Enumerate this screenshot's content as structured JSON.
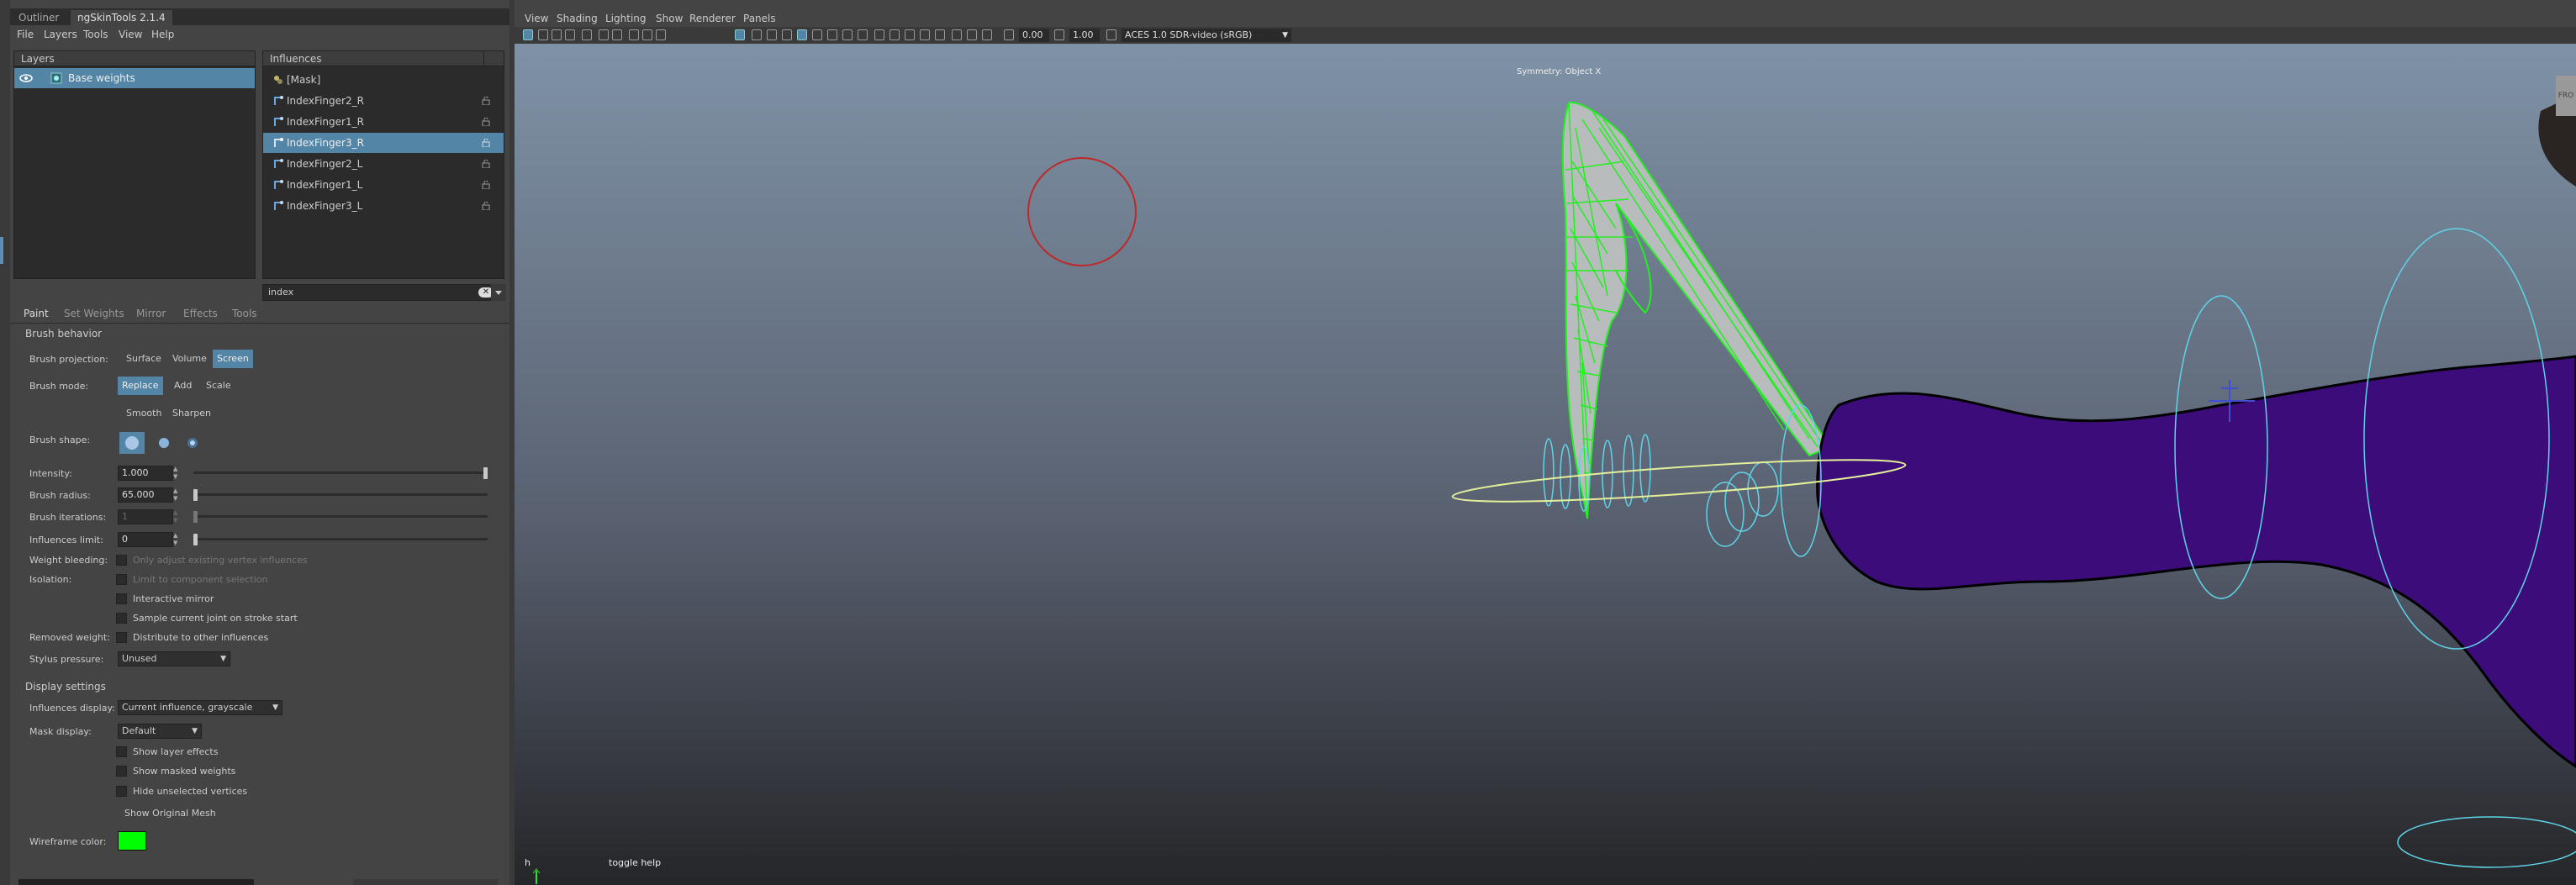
{
  "panel_tabs": [
    "Outliner",
    "ngSkinTools 2.1.4"
  ],
  "menu": [
    "File",
    "Layers",
    "Tools",
    "View",
    "Help"
  ],
  "layers": {
    "header": "Layers",
    "items": [
      {
        "name": "Base weights"
      }
    ]
  },
  "influences": {
    "header": "Influences",
    "items": [
      {
        "name": "[Mask]"
      },
      {
        "name": "IndexFinger2_R"
      },
      {
        "name": "IndexFinger1_R"
      },
      {
        "name": "IndexFinger3_R"
      },
      {
        "name": "IndexFinger2_L"
      },
      {
        "name": "IndexFinger1_L"
      },
      {
        "name": "IndexFinger3_L"
      }
    ],
    "selected": "IndexFinger3_R",
    "search": "index"
  },
  "settings_tabs": [
    "Paint",
    "Set Weights",
    "Mirror",
    "Effects",
    "Tools"
  ],
  "brush": {
    "section": "Brush behavior",
    "projection_label": "Brush projection:",
    "projection_options": [
      "Surface",
      "Volume",
      "Screen"
    ],
    "projection_selected": "Screen",
    "mode_label": "Brush mode:",
    "mode_options": [
      "Replace",
      "Add",
      "Scale"
    ],
    "mode_selected": "Replace",
    "mode_options_2": [
      "Smooth",
      "Sharpen"
    ],
    "shape_label": "Brush shape:",
    "intensity_label": "Intensity:",
    "intensity": "1.000",
    "intensity_level": 1.0,
    "radius_label": "Brush radius:",
    "radius": "65.000",
    "radius_level": 0.0,
    "iterations_label": "Brush iterations:",
    "iterations": "1",
    "iterations_level": 0.0,
    "inf_limit_label": "Influences limit:",
    "inf_limit": "0",
    "inf_limit_level": 0.0,
    "bleed_label": "Weight bleeding:",
    "bleed_option": "Only adjust existing vertex influences",
    "isolation_label": "Isolation:",
    "isolation_option": "Limit to component selection",
    "interactive_mirror": "Interactive mirror",
    "sample_joint": "Sample current joint on stroke start",
    "removed_label": "Removed weight:",
    "removed_option": "Distribute to other influences",
    "stylus_label": "Stylus pressure:",
    "stylus_value": "Unused"
  },
  "display": {
    "section": "Display settings",
    "inf_display_label": "Influences display:",
    "inf_display_value": "Current influence, grayscale",
    "mask_label": "Mask display:",
    "mask_value": "Default",
    "show_layer_effects": "Show layer effects",
    "show_masked": "Show masked weights",
    "hide_unselected": "Hide unselected vertices",
    "show_original": "Show Original Mesh",
    "wire_label": "Wireframe color:",
    "wire_color": "#00ff00"
  },
  "viewport": {
    "menu": [
      "View",
      "Shading",
      "Lighting",
      "Show",
      "Renderer",
      "Panels"
    ],
    "field1": "0.00",
    "field2": "1.00",
    "colorspace": "ACES 1.0 SDR-video (sRGB)",
    "symmetry": "Symmetry: Object X",
    "hotkey": "h",
    "hotkey_help": "toggle help",
    "corner": "FRO"
  }
}
